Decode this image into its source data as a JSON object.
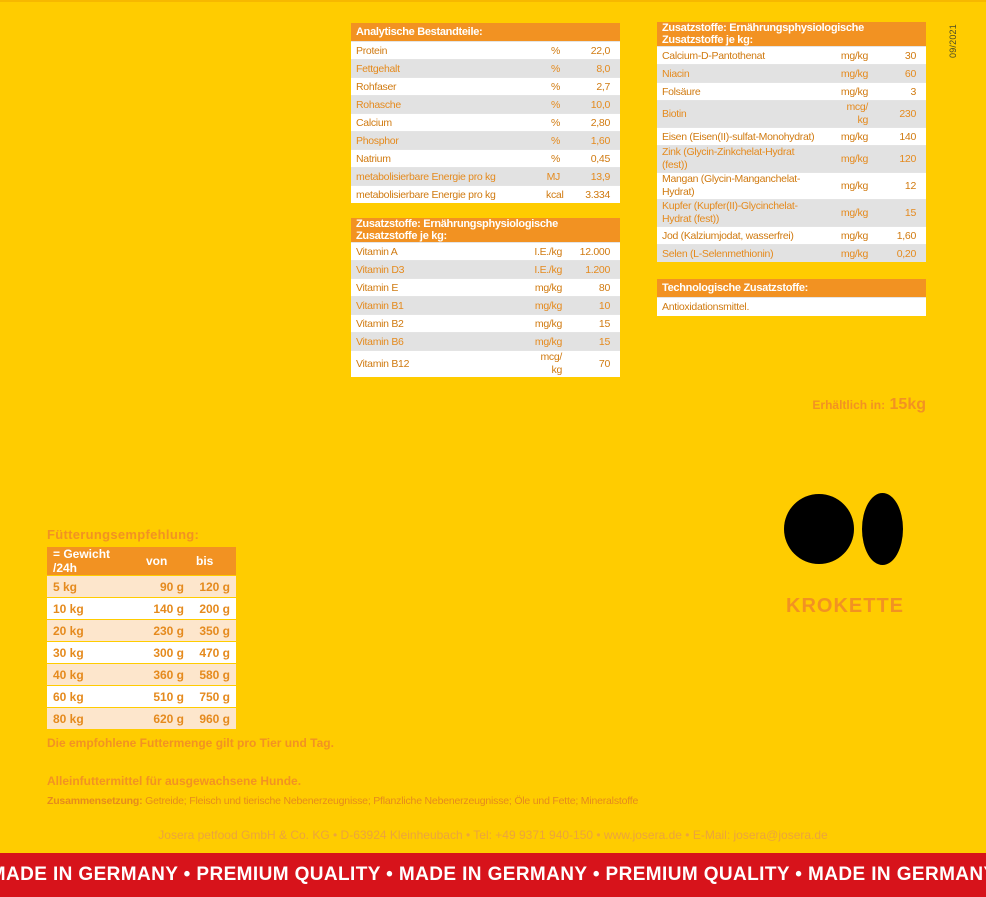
{
  "date_code": "09/2021",
  "analytical": {
    "title": "Analytische Bestandteile:",
    "rows": [
      {
        "name": "Protein",
        "unit": "%",
        "value": "22,0"
      },
      {
        "name": "Fettgehalt",
        "unit": "%",
        "value": "8,0"
      },
      {
        "name": "Rohfaser",
        "unit": "%",
        "value": "2,7"
      },
      {
        "name": "Rohasche",
        "unit": "%",
        "value": "10,0"
      },
      {
        "name": "Calcium",
        "unit": "%",
        "value": "2,80"
      },
      {
        "name": "Phosphor",
        "unit": "%",
        "value": "1,60"
      },
      {
        "name": "Natrium",
        "unit": "%",
        "value": "0,45"
      },
      {
        "name": "metabolisierbare Energie pro kg",
        "unit": "MJ",
        "value": "13,9"
      },
      {
        "name": "metabolisierbare Energie pro kg",
        "unit": "kcal",
        "value": "3.334"
      }
    ]
  },
  "vitamins": {
    "title": "Zusatzstoffe: Ernährungsphysiologische Zusatzstoffe je kg:",
    "rows": [
      {
        "name": "Vitamin A",
        "unit": "I.E./kg",
        "value": "12.000"
      },
      {
        "name": "Vitamin D3",
        "unit": "I.E./kg",
        "value": "1.200"
      },
      {
        "name": "Vitamin E",
        "unit": "mg/kg",
        "value": "80"
      },
      {
        "name": "Vitamin B1",
        "unit": "mg/kg",
        "value": "10"
      },
      {
        "name": "Vitamin B2",
        "unit": "mg/kg",
        "value": "15"
      },
      {
        "name": "Vitamin B6",
        "unit": "mg/kg",
        "value": "15"
      },
      {
        "name": "Vitamin B12",
        "unit": "mcg/\nkg",
        "value": "70"
      }
    ]
  },
  "minerals": {
    "title": "Zusatzstoffe: Ernährungsphysiologische Zusatzstoffe je kg:",
    "rows": [
      {
        "name": "Calcium-D-Pantothenat",
        "unit": "mg/kg",
        "value": "30"
      },
      {
        "name": "Niacin",
        "unit": "mg/kg",
        "value": "60"
      },
      {
        "name": "Folsäure",
        "unit": "mg/kg",
        "value": "3"
      },
      {
        "name": "Biotin",
        "unit": "mcg/\nkg",
        "value": "230"
      },
      {
        "name": "Eisen (Eisen(II)-sulfat-Monohydrat)",
        "unit": "mg/kg",
        "value": "140"
      },
      {
        "name": "Zink (Glycin-Zinkchelat-Hydrat (fest))",
        "unit": "mg/kg",
        "value": "120"
      },
      {
        "name": "Mangan (Glycin-Manganchelat-Hydrat)",
        "unit": "mg/kg",
        "value": "12"
      },
      {
        "name": "Kupfer (Kupfer(II)-Glycinchelat-Hydrat (fest))",
        "unit": "mg/kg",
        "value": "15"
      },
      {
        "name": "Jod (Kalziumjodat, wasserfrei)",
        "unit": "mg/kg",
        "value": "1,60"
      },
      {
        "name": "Selen (L-Selenmethionin)",
        "unit": "mg/kg",
        "value": "0,20"
      }
    ]
  },
  "technological": {
    "title": "Technologische Zusatzstoffe:",
    "text": "Antioxidationsmittel."
  },
  "availability": {
    "label": "Erhältlich in:",
    "size": "15kg"
  },
  "kibble_label": "KROKETTE",
  "feeding": {
    "title": "Fütterungsempfehlung:",
    "headers": [
      "= Gewicht /24h",
      "von",
      "bis"
    ],
    "rows": [
      [
        "5 kg",
        "90 g",
        "120 g"
      ],
      [
        "10 kg",
        "140 g",
        "200 g"
      ],
      [
        "20 kg",
        "230 g",
        "350 g"
      ],
      [
        "30 kg",
        "300 g",
        "470 g"
      ],
      [
        "40 kg",
        "360 g",
        "580 g"
      ],
      [
        "60 kg",
        "510 g",
        "750 g"
      ],
      [
        "80 kg",
        "620 g",
        "960 g"
      ]
    ],
    "note": "Die empfohlene Futtermenge gilt pro Tier und Tag."
  },
  "food_type": "Alleinfuttermittel für ausgewachsene Hunde.",
  "composition": {
    "label": "Zusammensetzung:",
    "text": " Getreide; Fleisch und tierische Nebenerzeugnisse; Pflanzliche Nebenerzeugnisse; Öle und Fette; Mineralstoffe"
  },
  "address": "Josera petfood GmbH & Co. KG • D-63924 Kleinheubach • Tel: +49 9371 940-150 • www.josera.de • E-Mail: josera@josera.de",
  "banner": "• MADE IN GERMANY • PREMIUM QUALITY • MADE IN GERMANY • PREMIUM QUALITY • MADE IN GERMANY •",
  "colors": {
    "background": "#ffcc00",
    "accent": "#f29222",
    "banner": "#d7131b"
  }
}
